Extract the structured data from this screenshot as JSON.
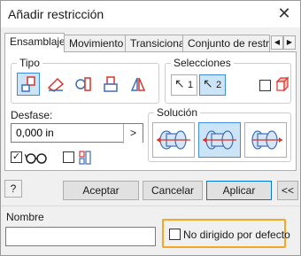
{
  "window": {
    "title": "Añadir restricción",
    "close_glyph": "✕"
  },
  "tabs": [
    {
      "label": "Ensamblaje",
      "active": true
    },
    {
      "label": "Movimiento",
      "active": false
    },
    {
      "label": "Transicional",
      "active": false
    },
    {
      "label": "Conjunto de restricciones",
      "active": false
    }
  ],
  "tab_scroll": {
    "left": "◀",
    "right": "▶"
  },
  "tipo": {
    "label": "Tipo",
    "buttons": [
      {
        "icon": "mate-icon",
        "selected": true
      },
      {
        "icon": "angle-icon",
        "selected": false
      },
      {
        "icon": "tangent-icon",
        "selected": false
      },
      {
        "icon": "insert-icon",
        "selected": false
      },
      {
        "icon": "symmetry-icon",
        "selected": false
      }
    ]
  },
  "selecciones": {
    "label": "Selecciones",
    "sel1": "1",
    "sel2": "2",
    "cursor_glyph": "↖",
    "first_select_checked": false,
    "one_click_icon": "part-select-icon"
  },
  "desfase": {
    "label": "Desfase:",
    "value": "0,000 in",
    "arrow_glyph": ">"
  },
  "preview": {
    "checked": true,
    "glyph": "✓",
    "icon": "glasses-icon"
  },
  "predict_offset": {
    "checked": false,
    "icon": "predict-offset-icon"
  },
  "solucion": {
    "label": "Solución",
    "options": [
      {
        "icon": "mate-opposed-icon",
        "selected": false
      },
      {
        "icon": "mate-aligned-icon",
        "selected": true
      },
      {
        "icon": "flush-icon",
        "selected": false
      }
    ]
  },
  "footer": {
    "help_glyph": "?",
    "accept": "Aceptar",
    "cancel": "Cancelar",
    "apply": "Aplicar",
    "more": "<<"
  },
  "bottom": {
    "name_label": "Nombre",
    "name_value": "",
    "no_default_checked": false,
    "no_default_label": "No dirigido por defecto"
  },
  "colors": {
    "accent": "#3d8ee0",
    "highlight_fill": "#cce4f7",
    "orange_outline": "#f5a623",
    "icon_red": "#d9342b"
  }
}
